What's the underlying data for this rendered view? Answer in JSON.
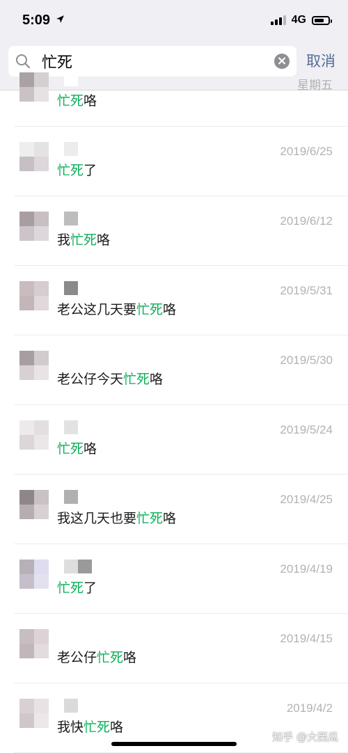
{
  "status_bar": {
    "time": "5:09",
    "location_icon": "location-arrow-icon",
    "network": "4G",
    "battery_level": 0.7
  },
  "search": {
    "query": "忙死",
    "cancel_label": "取消",
    "icons": {
      "search": "search-icon",
      "clear": "clear-icon"
    }
  },
  "colors": {
    "highlight": "#06ae56",
    "cancel": "#576b95",
    "date": "#b2b2b2",
    "header_bg": "#efeff4"
  },
  "results": [
    {
      "date": "星期五",
      "pre": "",
      "kw": "忙死",
      "post": "咯"
    },
    {
      "date": "2019/6/25",
      "pre": "",
      "kw": "忙死",
      "post": "了"
    },
    {
      "date": "2019/6/12",
      "pre": "我",
      "kw": "忙死",
      "post": "咯"
    },
    {
      "date": "2019/5/31",
      "pre": "老公这几天要",
      "kw": "忙死",
      "post": "咯"
    },
    {
      "date": "2019/5/30",
      "pre": "老公仔今天",
      "kw": "忙死",
      "post": "咯"
    },
    {
      "date": "2019/5/24",
      "pre": "",
      "kw": "忙死",
      "post": "咯"
    },
    {
      "date": "2019/4/25",
      "pre": "我这几天也要",
      "kw": "忙死",
      "post": "咯"
    },
    {
      "date": "2019/4/19",
      "pre": "",
      "kw": "忙死",
      "post": "了"
    },
    {
      "date": "2019/4/15",
      "pre": "老公仔",
      "kw": "忙死",
      "post": "咯"
    },
    {
      "date": "2019/4/2",
      "pre": "我快",
      "kw": "忙死",
      "post": "咯"
    }
  ],
  "watermark": "知乎 @大西瓜"
}
